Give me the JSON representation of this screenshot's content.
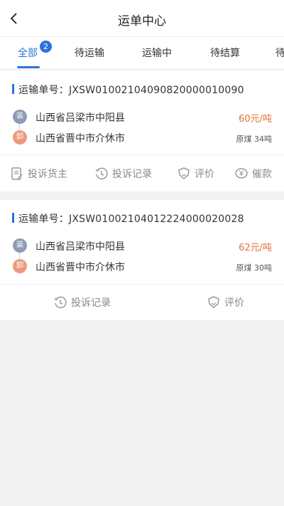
{
  "header": {
    "title": "运单中心"
  },
  "tabs": [
    {
      "label": "全部",
      "badge": "2",
      "active": true
    },
    {
      "label": "待运输"
    },
    {
      "label": "运输中"
    },
    {
      "label": "待结算"
    },
    {
      "label": "待"
    }
  ],
  "orders": [
    {
      "order_label": "运输单号：JXSW01002104090820000010090",
      "load_tag": "装",
      "unload_tag": "卸",
      "from": "山西省吕梁市中阳县",
      "to": "山西省晋中市介休市",
      "price": "60元/吨",
      "cargo": "原煤 34吨",
      "actions": [
        "投诉货主",
        "投诉记录",
        "评价",
        "催款"
      ]
    },
    {
      "order_label": "运输单号：JXSW01002104012224000020028",
      "load_tag": "装",
      "unload_tag": "卸",
      "from": "山西省吕梁市中阳县",
      "to": "山西省晋中市介休市",
      "price": "62元/吨",
      "cargo": "原煤 30吨",
      "actions": [
        "投诉记录",
        "评价"
      ]
    }
  ],
  "colors": {
    "accent": "#2b73d6",
    "price": "#e2703a",
    "load": "#8f9bb5",
    "unload": "#ec9a7d"
  }
}
